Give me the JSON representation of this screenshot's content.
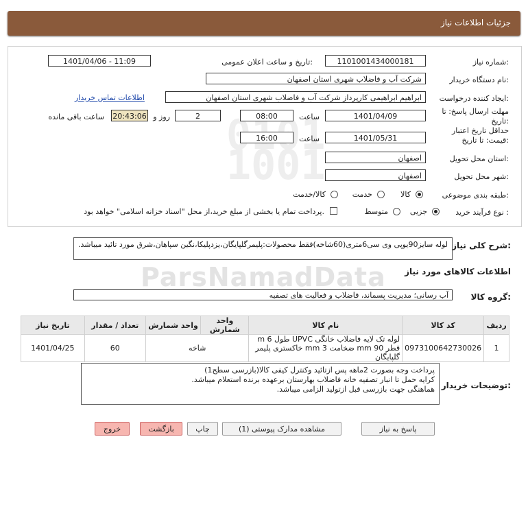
{
  "header": {
    "title": "جزئیات اطلاعات نیاز"
  },
  "form": {
    "need_number_label": "شماره نیاز:",
    "need_number": "1101001434000181",
    "announce_label": "تاریخ و ساعت اعلان عمومی:",
    "announce_value": "1401/04/06 - 11:09",
    "buyer_label": "نام دستگاه خریدار:",
    "buyer_value": "شرکت آب و فاضلاب شهری استان اصفهان",
    "creator_label": "ایجاد کننده درخواست:",
    "creator_value": "ابراهیم ابراهیمی کارپرداز شرکت آب و فاضلاب شهری استان اصفهان",
    "contact_link": "اطلاعات تماس خریدار",
    "deadline_label_1": "مهلت ارسال پاسخ: تا",
    "deadline_label_2": "تاریخ:",
    "deadline_date": "1401/04/09",
    "time_label": "ساعت",
    "deadline_time": "08:00",
    "days_value": "2",
    "days_label": "روز و",
    "remaining_time": "20:43:06",
    "remaining_label": "ساعت باقی مانده",
    "validity_label_1": "حداقل تاریخ اعتبار",
    "validity_label_2": "قیمت: تا تاریخ:",
    "validity_date": "1401/05/31",
    "validity_time": "16:00",
    "province_label": "استان محل تحویل:",
    "province_value": "اصفهان",
    "city_label": "شهر محل تحویل:",
    "city_value": "اصفهان",
    "category_label": "طبقه بندی موضوعی:",
    "category_options": [
      "کالا",
      "خدمت",
      "کالا/خدمت"
    ],
    "category_selected": 0,
    "process_label": "نوع فرآیند خرید :",
    "process_options": [
      "جزیی",
      "متوسط"
    ],
    "process_selected": 0,
    "treasury_text": "پرداخت تمام یا بخشی از مبلغ خرید،از محل \"اسناد خزانه اسلامی\" خواهد بود."
  },
  "summary": {
    "label": "شرح کلی نیاز:",
    "text": "لوله سایز90یوپی وی سی6متری(60شاخه)فقط محصولات:پلیمرگلپایگان،یزدپلیکا،نگین سپاهان،شرق مورد تائید میباشد."
  },
  "goods": {
    "section_title": "اطلاعات کالاهای مورد نیاز",
    "group_label": "گروه کالا:",
    "group_value": "آب رسانی؛ مدیریت پسماند، فاضلاب و فعالیت های تصفیه",
    "columns": [
      "ردیف",
      "کد کالا",
      "نام کالا",
      "واحد شمارش",
      "تعداد / مقدار",
      "تاریخ نیاز"
    ],
    "rows": [
      {
        "index": "1",
        "code": "0973100642730026",
        "name": "لوله تک لایه فاضلاب خانگی UPVC طول 6 m قطر 90 mm ضخامت 3 mm خاکستری پلیمر گلپایگان",
        "unit": "شاخه",
        "qty": "60",
        "date": "1401/04/25"
      }
    ]
  },
  "buyer_notes": {
    "label": "توضیحات خریدار:",
    "lines": [
      "پرداخت وجه بصورت 2ماهه پس ازتائید وکنترل کیفی کالا(بازرسی سطح1)",
      "کرایه حمل تا انبار تصفیه خانه فاضلاب بهارستان برعهده برنده استعلام میباشد.",
      "هماهنگی جهت بازرسی قبل ازتولید الزامی میباشد."
    ]
  },
  "buttons": {
    "reply": "پاسخ به نیاز",
    "docs": "مشاهده مدارک پیوستی (1)",
    "print": "چاپ",
    "back": "بازگشت",
    "exit": "خروج"
  }
}
